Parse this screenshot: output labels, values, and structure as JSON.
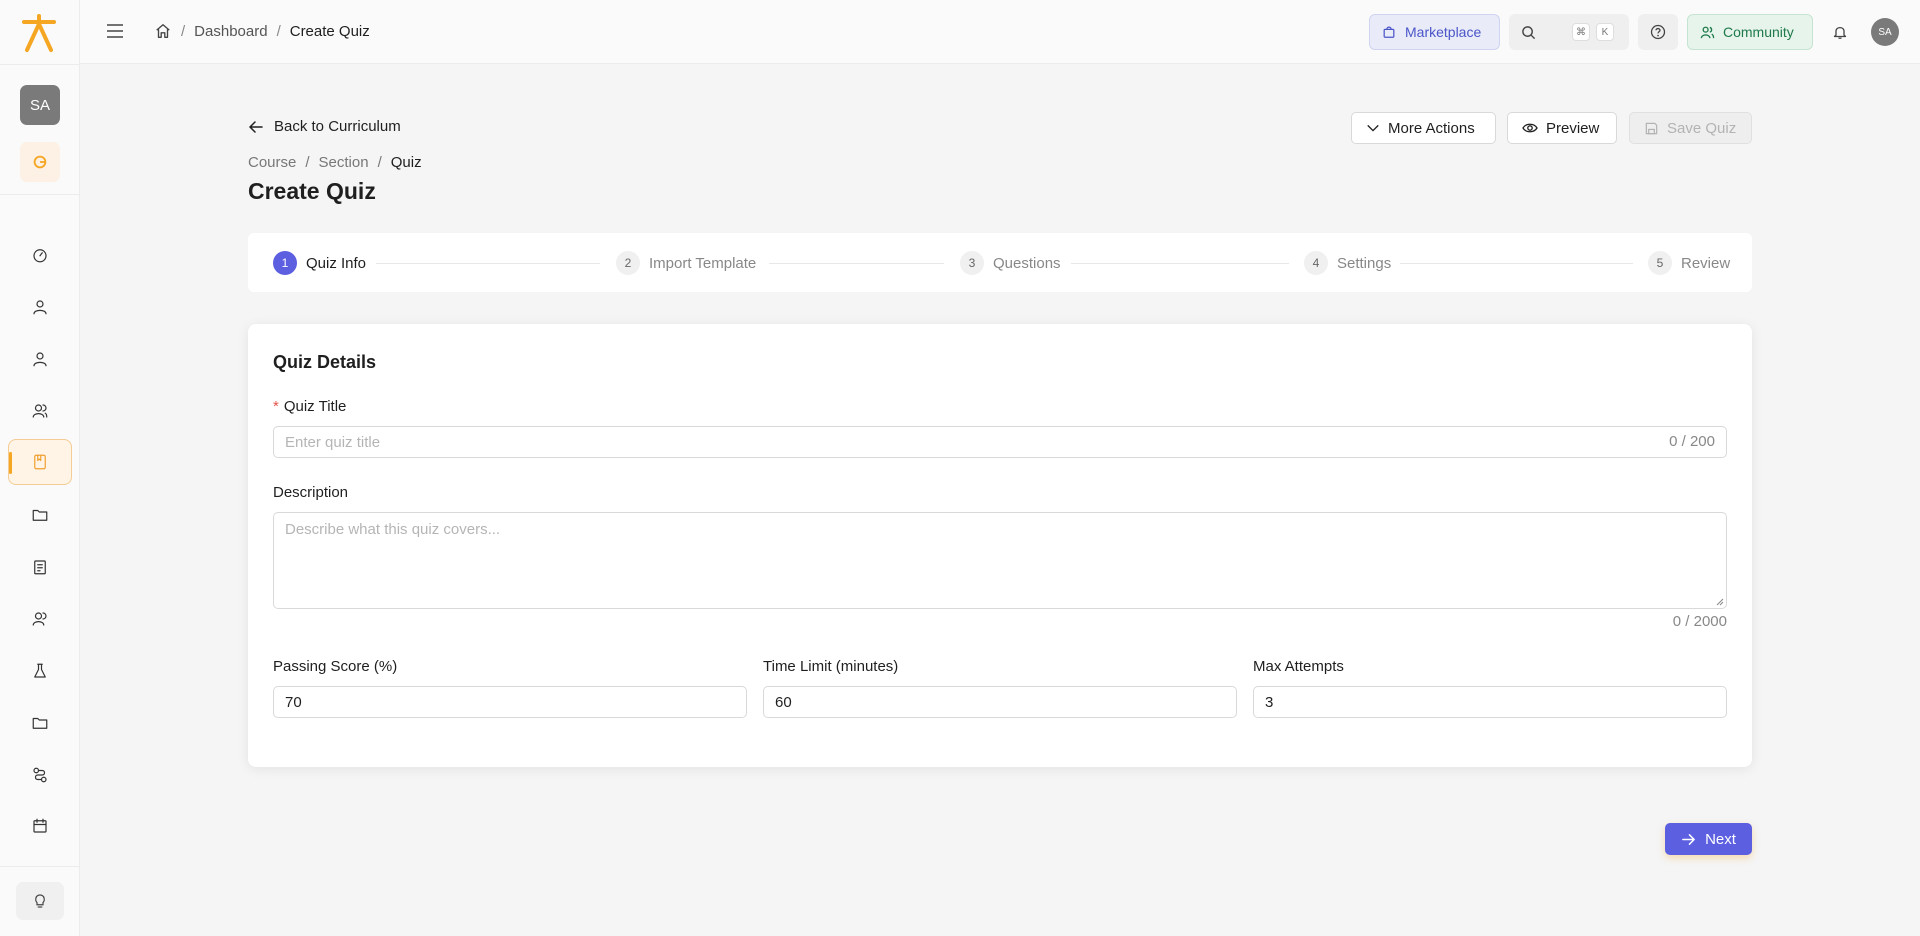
{
  "sidebar": {
    "workspace_initials": "SA",
    "nav_items": [
      {
        "name": "dashboard",
        "icon": "gauge-icon"
      },
      {
        "name": "user",
        "icon": "user-icon"
      },
      {
        "name": "profile",
        "icon": "user-icon"
      },
      {
        "name": "team",
        "icon": "users-icon"
      },
      {
        "name": "courses",
        "icon": "book-icon",
        "active": true
      },
      {
        "name": "files",
        "icon": "folder-icon"
      },
      {
        "name": "assessments",
        "icon": "clipboard-icon"
      },
      {
        "name": "groups",
        "icon": "users-icon"
      },
      {
        "name": "lab",
        "icon": "flask-icon"
      },
      {
        "name": "folders",
        "icon": "folder-icon"
      },
      {
        "name": "workflow",
        "icon": "route-icon"
      },
      {
        "name": "calendar",
        "icon": "calendar-icon"
      }
    ]
  },
  "topbar": {
    "breadcrumb": [
      "Dashboard",
      "Create Quiz"
    ],
    "marketplace_label": "Marketplace",
    "search_kbd": [
      "⌘",
      "K"
    ],
    "community_label": "Community",
    "user_initials": "SA"
  },
  "header": {
    "back_label": "Back to Curriculum",
    "breadcrumb": [
      "Course",
      "Section",
      "Quiz"
    ],
    "title": "Create Quiz",
    "more_actions_label": "More Actions",
    "preview_label": "Preview",
    "save_label": "Save Quiz"
  },
  "stepper": {
    "steps": [
      {
        "num": "1",
        "label": "Quiz Info"
      },
      {
        "num": "2",
        "label": "Import Template"
      },
      {
        "num": "3",
        "label": "Questions"
      },
      {
        "num": "4",
        "label": "Settings"
      },
      {
        "num": "5",
        "label": "Review"
      }
    ],
    "active_step": 1
  },
  "form": {
    "section_title": "Quiz Details",
    "title_label": "Quiz Title",
    "title_placeholder": "Enter quiz title",
    "title_counter": "0 / 200",
    "description_label": "Description",
    "description_placeholder": "Describe what this quiz covers...",
    "description_counter": "0 / 2000",
    "passing_label": "Passing Score (%)",
    "passing_value": "70",
    "time_label": "Time Limit (minutes)",
    "time_value": "60",
    "attempts_label": "Max Attempts",
    "attempts_value": "3"
  },
  "footer": {
    "next_label": "Next"
  },
  "colors": {
    "accent": "#5b5fe0",
    "brand": "#f5a623"
  }
}
